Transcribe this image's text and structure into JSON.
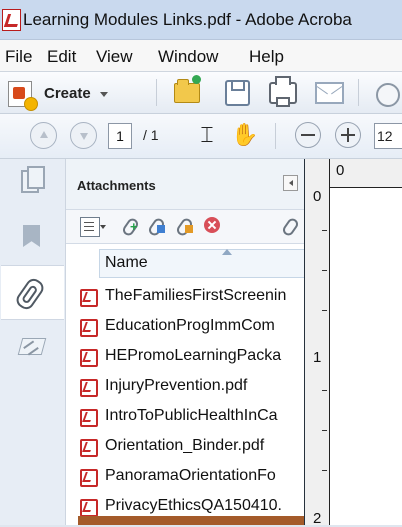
{
  "window": {
    "title": "Learning Modules Links.pdf - Adobe Acroba"
  },
  "menu": {
    "items": [
      "File",
      "Edit",
      "View",
      "Window",
      "Help"
    ]
  },
  "toolbar": {
    "create_label": "Create"
  },
  "navigation": {
    "current_page": "1",
    "page_count": "/ 1",
    "zoom_partial": "12"
  },
  "attachments": {
    "title": "Attachments",
    "column_name": "Name",
    "files": [
      "TheFamiliesFirstScreenin",
      "EducationProgImmCom",
      "HEPromoLearningPacka",
      "InjuryPrevention.pdf",
      "IntroToPublicHealthInCa",
      "Orientation_Binder.pdf",
      "PanoramaOrientationFo",
      "PrivacyEthicsQA150410."
    ]
  },
  "document": {
    "ruler_top": "0",
    "ruler_left_0": "0",
    "ruler_left_1": "1",
    "ruler_left_2": "2"
  }
}
